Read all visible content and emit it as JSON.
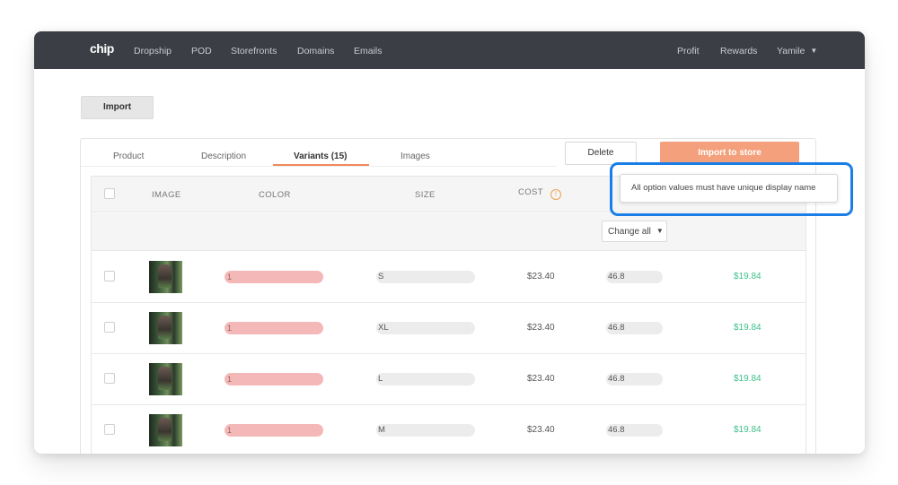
{
  "navbar": {
    "logo": "chip",
    "left_links": [
      "Dropship",
      "POD",
      "Storefronts",
      "Domains",
      "Emails"
    ],
    "right_links": [
      "Profit",
      "Rewards"
    ],
    "user": "Yamile"
  },
  "import_button": "Import",
  "tabs": [
    {
      "label": "Product",
      "active": false
    },
    {
      "label": "Description",
      "active": false
    },
    {
      "label": "Variants (15)",
      "active": true
    },
    {
      "label": "Images",
      "active": false
    }
  ],
  "actions": {
    "delete": "Delete",
    "import_to_store": "Import to store"
  },
  "table": {
    "headers": {
      "image": "IMAGE",
      "color": "COLOR",
      "size": "SIZE",
      "cost": "COST"
    },
    "change_all": "Change all",
    "rows": [
      {
        "color": "1",
        "size": "S",
        "cost": "$23.40",
        "margin": "46.8",
        "profit": "$19.84"
      },
      {
        "color": "1",
        "size": "XL",
        "cost": "$23.40",
        "margin": "46.8",
        "profit": "$19.84"
      },
      {
        "color": "1",
        "size": "L",
        "cost": "$23.40",
        "margin": "46.8",
        "profit": "$19.84"
      },
      {
        "color": "1",
        "size": "M",
        "cost": "$23.40",
        "margin": "46.8",
        "profit": "$19.84"
      }
    ]
  },
  "tooltip": "All option values must have unique display name",
  "colors": {
    "navbar": "#3b3e44",
    "accent_orange": "#f4a07c",
    "profit_green": "#3cc08a",
    "highlight_blue": "#1a7ee6"
  },
  "icons": {
    "info": "info-circle-icon",
    "dropdown": "chevron-down-icon"
  }
}
